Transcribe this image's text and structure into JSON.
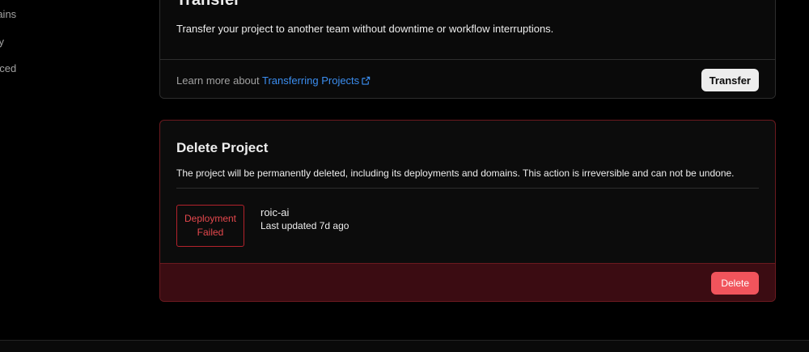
{
  "sidebar": {
    "items": [
      {
        "label": "rains"
      },
      {
        "label": "ity"
      },
      {
        "label": "nced"
      }
    ]
  },
  "transfer": {
    "title": "Transfer",
    "description": "Transfer your project to another team without downtime or workflow interruptions.",
    "learn_more_prefix": "Learn more about ",
    "learn_more_link": "Transferring Projects",
    "button_label": "Transfer"
  },
  "delete": {
    "title": "Delete Project",
    "description": "The project will be permanently deleted, including its deployments and domains. This action is irreversible and can not be undone.",
    "status_line1": "Deployment",
    "status_line2": "Failed",
    "project_name": "roic-ai",
    "last_updated": "Last updated 7d ago",
    "button_label": "Delete"
  },
  "colors": {
    "link": "#3b8ef0",
    "danger": "#f1545c",
    "danger_bg": "#3b0c12",
    "status_error": "#e5484d"
  }
}
